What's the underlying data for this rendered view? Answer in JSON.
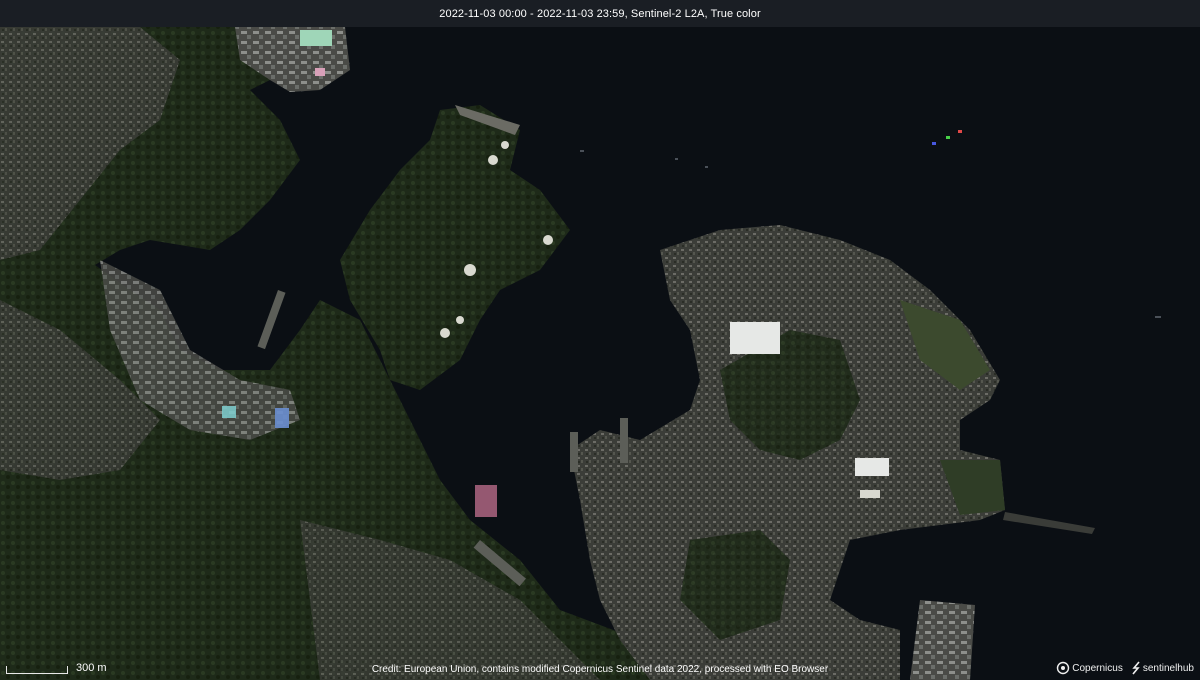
{
  "header": {
    "title": "2022-11-03 00:00 - 2022-11-03 23:59, Sentinel-2 L2A, True color"
  },
  "scale": {
    "label": "300 m"
  },
  "footer": {
    "credit": "Credit: European Union, contains modified Copernicus Sentinel data 2022, processed with EO Browser",
    "logo_copernicus": "Copernicus",
    "logo_sentinelhub": "sentinelhub"
  },
  "colors": {
    "water": "#0b0f14",
    "vegetation": "#1f2b1a",
    "urban": "#5a5a55",
    "header_bg": "#2c3036"
  }
}
